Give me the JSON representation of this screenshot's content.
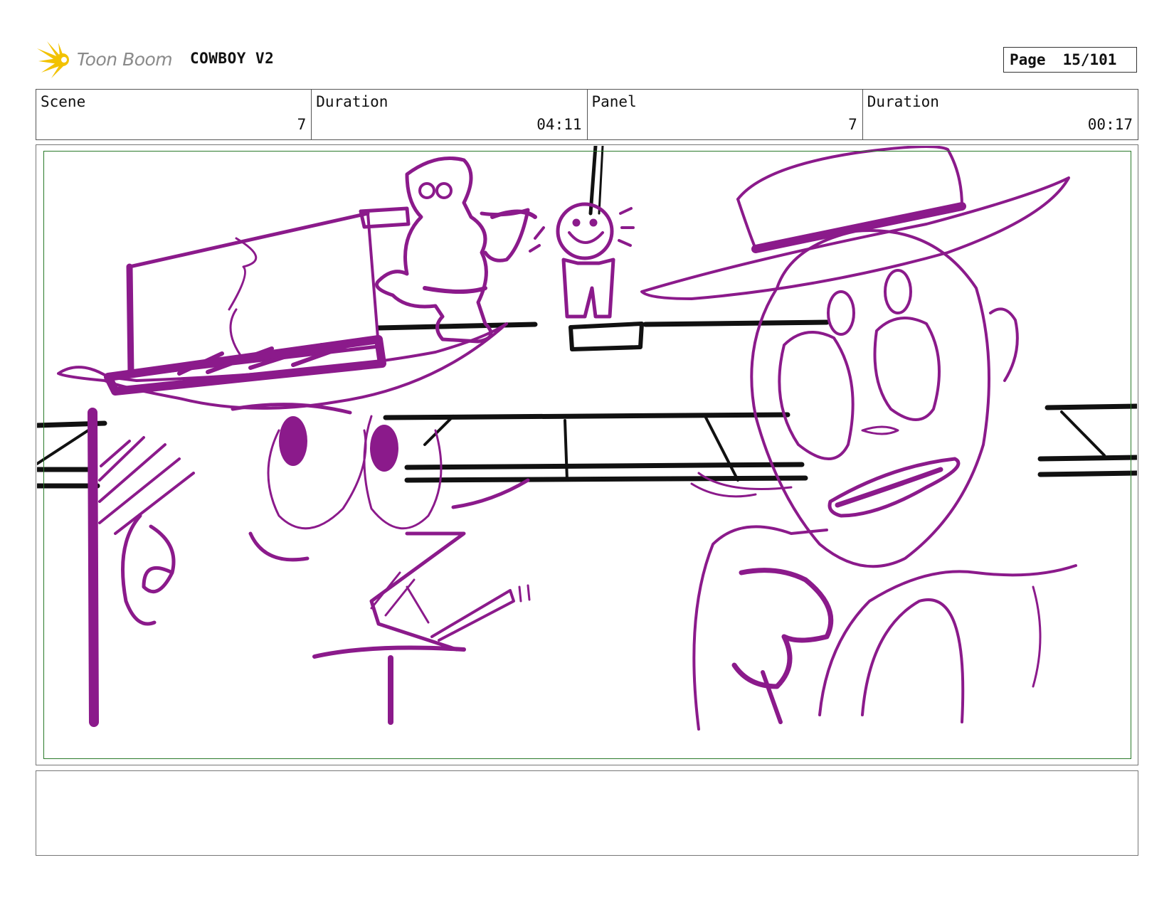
{
  "header": {
    "logo_text": "Toon Boom",
    "project_title": "COWBOY V2",
    "page_label": "Page",
    "page_number": "15/101"
  },
  "info": {
    "scene_label": "Scene",
    "scene_value": "7",
    "scene_duration_label": "Duration",
    "scene_duration_value": "04:11",
    "panel_label": "Panel",
    "panel_value": "7",
    "panel_duration_label": "Duration",
    "panel_duration_value": "00:17"
  },
  "colors": {
    "sketch_purple": "#8b1a8b",
    "sketch_black": "#111111",
    "safe_area_green": "#2a7a2a",
    "logo_yellow": "#f2c200"
  },
  "notes": {
    "text": ""
  }
}
